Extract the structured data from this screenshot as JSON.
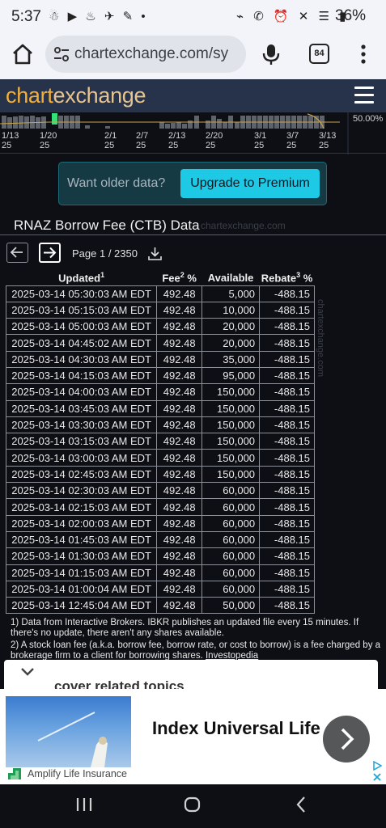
{
  "status_bar": {
    "time": "5:37",
    "battery": "36%"
  },
  "browser": {
    "url": "chartexchange.com/sy",
    "tab_count": "84"
  },
  "site": {
    "logo_part1": "chart",
    "logo_part2": "exchange"
  },
  "mini_chart": {
    "pct_label": "50.00%",
    "dates": [
      "1/13\n25",
      "1/20\n25",
      "2/1\n25",
      "2/7\n25",
      "2/13\n25",
      "2/20\n25",
      "3/1\n25",
      "3/7\n25",
      "3/13\n25"
    ]
  },
  "premium": {
    "message": "Want older data?",
    "button": "Upgrade to Premium"
  },
  "section": {
    "title": "RNAZ Borrow Fee (CTB) Data",
    "watermark": "chartexchange.com"
  },
  "pager": {
    "text": "Page 1 / 2350"
  },
  "table": {
    "headers": {
      "updated": "Updated",
      "fee": "Fee",
      "available": "Available",
      "rebate": "Rebate"
    },
    "header_sups": {
      "updated": "1",
      "fee": "2",
      "rebate": "3"
    },
    "header_fee_suffix": " %",
    "header_rebate_suffix": " %",
    "watermark": "chartexchange.com",
    "rows": [
      [
        "2025-03-14 05:30:03 AM EDT",
        "492.48",
        "5,000",
        "-488.15"
      ],
      [
        "2025-03-14 05:15:03 AM EDT",
        "492.48",
        "10,000",
        "-488.15"
      ],
      [
        "2025-03-14 05:00:03 AM EDT",
        "492.48",
        "20,000",
        "-488.15"
      ],
      [
        "2025-03-14 04:45:02 AM EDT",
        "492.48",
        "20,000",
        "-488.15"
      ],
      [
        "2025-03-14 04:30:03 AM EDT",
        "492.48",
        "35,000",
        "-488.15"
      ],
      [
        "2025-03-14 04:15:03 AM EDT",
        "492.48",
        "95,000",
        "-488.15"
      ],
      [
        "2025-03-14 04:00:03 AM EDT",
        "492.48",
        "150,000",
        "-488.15"
      ],
      [
        "2025-03-14 03:45:03 AM EDT",
        "492.48",
        "150,000",
        "-488.15"
      ],
      [
        "2025-03-14 03:30:03 AM EDT",
        "492.48",
        "150,000",
        "-488.15"
      ],
      [
        "2025-03-14 03:15:03 AM EDT",
        "492.48",
        "150,000",
        "-488.15"
      ],
      [
        "2025-03-14 03:00:03 AM EDT",
        "492.48",
        "150,000",
        "-488.15"
      ],
      [
        "2025-03-14 02:45:03 AM EDT",
        "492.48",
        "150,000",
        "-488.15"
      ],
      [
        "2025-03-14 02:30:03 AM EDT",
        "492.48",
        "60,000",
        "-488.15"
      ],
      [
        "2025-03-14 02:15:03 AM EDT",
        "492.48",
        "60,000",
        "-488.15"
      ],
      [
        "2025-03-14 02:00:03 AM EDT",
        "492.48",
        "60,000",
        "-488.15"
      ],
      [
        "2025-03-14 01:45:03 AM EDT",
        "492.48",
        "60,000",
        "-488.15"
      ],
      [
        "2025-03-14 01:30:03 AM EDT",
        "492.48",
        "60,000",
        "-488.15"
      ],
      [
        "2025-03-14 01:15:03 AM EDT",
        "492.48",
        "60,000",
        "-488.15"
      ],
      [
        "2025-03-14 01:00:04 AM EDT",
        "492.48",
        "60,000",
        "-488.15"
      ],
      [
        "2025-03-14 12:45:04 AM EDT",
        "492.48",
        "50,000",
        "-488.15"
      ]
    ]
  },
  "footnotes": {
    "note1": "1) Data from Interactive Brokers. IBKR publishes an updated file every 15 minutes. If there's no update, there aren't any shares available.",
    "note2": "2) A stock loan fee (a.k.a. borrow fee, borrow rate, or cost to borrow) is a fee charged by a brokerage firm to a client for borrowing shares.",
    "note2_link": "Investopedia"
  },
  "related": {
    "text": "cover related topics"
  },
  "ad": {
    "title": "Index Universal Life",
    "brand": "Amplify Life Insurance"
  },
  "colors": {
    "accent_cyan": "#1ec9e6",
    "logo_orange": "#f2b03a",
    "header_bg": "#27334a",
    "page_bg": "#0d0f14"
  }
}
